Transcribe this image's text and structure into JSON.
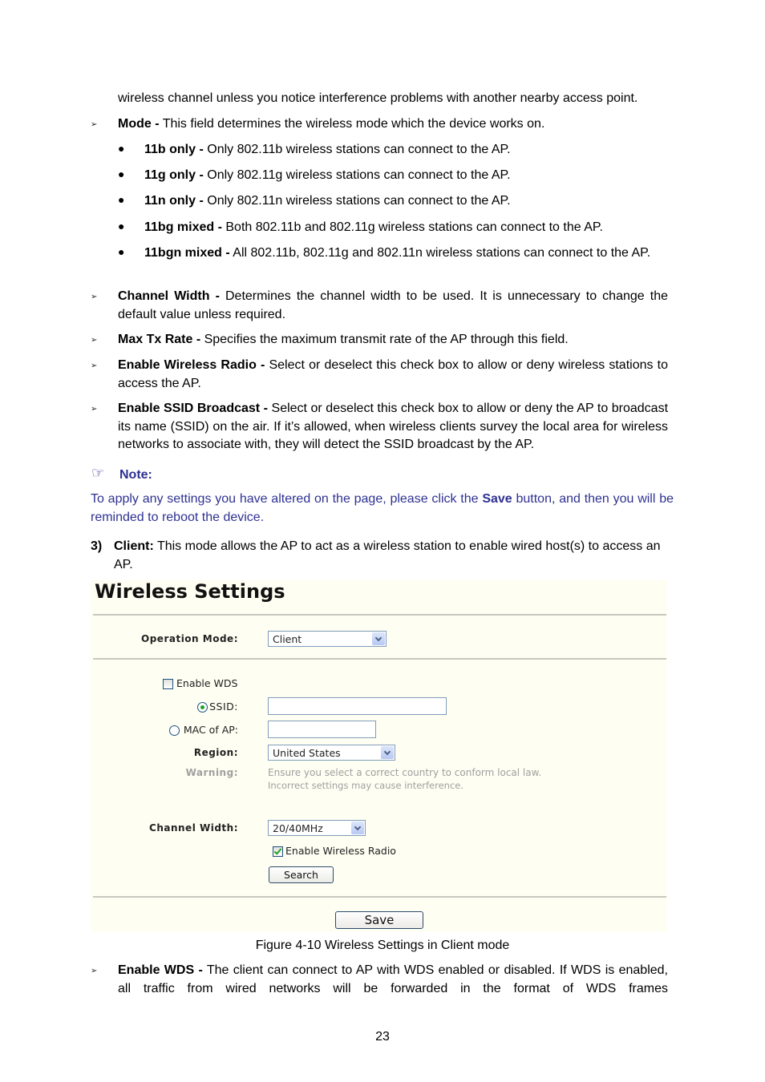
{
  "doc": {
    "intro_continuation": "wireless channel unless you notice interference problems with another nearby access point.",
    "mode": {
      "term": "Mode -",
      "desc": " This field determines the wireless mode which the device works on.",
      "options": [
        {
          "term": "11b only -",
          "desc": " Only 802.11b wireless stations can connect to the AP."
        },
        {
          "term": "11g only -",
          "desc": " Only 802.11g wireless stations can connect to the AP."
        },
        {
          "term": "11n only -",
          "desc": " Only 802.11n wireless stations can connect to the AP."
        },
        {
          "term": "11bg mixed -",
          "desc": " Both 802.11b and 802.11g wireless stations can connect to the AP."
        },
        {
          "term": "11bgn mixed -",
          "desc": " All 802.11b, 802.11g and 802.11n wireless stations can connect to the AP."
        }
      ]
    },
    "items": [
      {
        "term": "Channel Width -",
        "desc": " Determines the channel width to be used. It is unnecessary to change the default value unless required."
      },
      {
        "term": "Max Tx Rate -",
        "desc": " Specifies the maximum transmit rate of the AP through this field."
      },
      {
        "term": "Enable Wireless Radio -",
        "desc": " Select or deselect this check box to allow or deny wireless stations to access the AP."
      },
      {
        "term": "Enable SSID Broadcast -",
        "desc": " Select or deselect this check box to allow or deny the AP to broadcast its name (SSID) on the air. If it’s allowed, when wireless clients survey the local area for wireless networks to associate with, they will detect the SSID broadcast by the AP."
      }
    ],
    "note": {
      "icon": "pointing-hand-icon",
      "title": "Note:",
      "text_before": "To apply any settings you have altered on the page, please click the ",
      "text_bold": "Save",
      "text_after": " button, and then you will be reminded to reboot the device."
    },
    "client": {
      "number": "3)",
      "term": "Client:",
      "desc": " This mode allows the AP to act as a wireless station to enable wired host(s) to access an AP."
    },
    "figure": {
      "title": "Wireless Settings",
      "operation_mode_label": "Operation Mode:",
      "operation_mode_value": "Client",
      "enable_wds_label": "Enable WDS",
      "enable_wds_checked": false,
      "ssid_label": "SSID:",
      "ssid_selected": true,
      "ssid_value": "",
      "mac_label": "MAC of AP:",
      "mac_selected": false,
      "mac_value": "",
      "region_label": "Region:",
      "region_value": "United States",
      "warning_label": "Warning:",
      "warning_line1": "Ensure you select a correct country to conform local law.",
      "warning_line2": "Incorrect settings may cause interference.",
      "channel_width_label": "Channel Width:",
      "channel_width_value": "20/40MHz",
      "enable_radio_label": "Enable Wireless Radio",
      "enable_radio_checked": true,
      "search_button": "Search",
      "save_button": "Save"
    },
    "caption": "Figure 4-10 Wireless Settings in Client mode",
    "wds": {
      "term": "Enable WDS -",
      "desc": " The client can connect to AP with WDS enabled or disabled. If WDS is enabled, all traffic from wired networks will be forwarded in the format of WDS frames"
    },
    "page_number": "23"
  }
}
